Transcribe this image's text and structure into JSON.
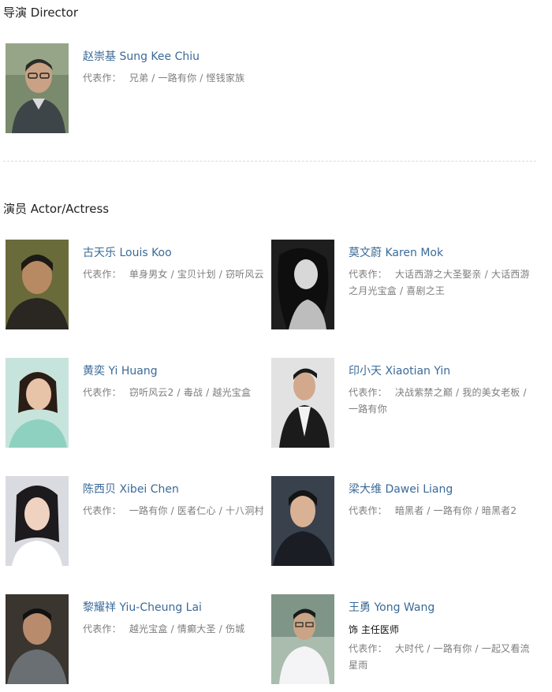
{
  "directors_section": {
    "title": "导演 Director",
    "people": [
      {
        "name": "赵崇基 Sung Kee Chiu",
        "role": "",
        "works_label": "代表作：",
        "works": "兄弟 / 一路有你 / 悭钱家族",
        "photo_bg": "#5f6d55"
      }
    ]
  },
  "actors_section": {
    "title": "演员 Actor/Actress",
    "people": [
      {
        "name": "古天乐 Louis Koo",
        "role": "",
        "works_label": "代表作：",
        "works": "单身男女 / 宝贝计划 / 窃听风云",
        "photo_bg": "#6b6a3c"
      },
      {
        "name": "莫文蔚 Karen Mok",
        "role": "",
        "works_label": "代表作：",
        "works": "大话西游之大圣娶亲 / 大话西游之月光宝盒 / 喜剧之王",
        "photo_bg": "#2b2b2b"
      },
      {
        "name": "黄奕 Yi Huang",
        "role": "",
        "works_label": "代表作：",
        "works": "窃听风云2 / 毒战 / 越光宝盒",
        "photo_bg": "#bfe0d8"
      },
      {
        "name": "印小天 Xiaotian Yin",
        "role": "",
        "works_label": "代表作：",
        "works": "决战紫禁之巅 / 我的美女老板 / 一路有你",
        "photo_bg": "#dcdcdc"
      },
      {
        "name": "陈西贝 Xibei Chen",
        "role": "",
        "works_label": "代表作：",
        "works": "一路有你 / 医者仁心 / 十八洞村",
        "photo_bg": "#d8d8dc"
      },
      {
        "name": "梁大维 Dawei Liang",
        "role": "",
        "works_label": "代表作：",
        "works": "暗黑者 / 一路有你 / 暗黑者2",
        "photo_bg": "#2f3640"
      },
      {
        "name": "黎耀祥 Yiu-Cheung Lai",
        "role": "",
        "works_label": "代表作：",
        "works": "越光宝盒 / 情癫大圣 / 伤城",
        "photo_bg": "#3a3530"
      },
      {
        "name": "王勇 Yong Wang",
        "role": "饰 主任医师",
        "works_label": "代表作：",
        "works": "大时代 / 一路有你 / 一起又看流星雨",
        "photo_bg": "#9db0a0"
      }
    ]
  },
  "colors": {
    "name_link": "#3a6a98",
    "works_text": "#7d7d7d",
    "divider": "#dcdcdc"
  }
}
